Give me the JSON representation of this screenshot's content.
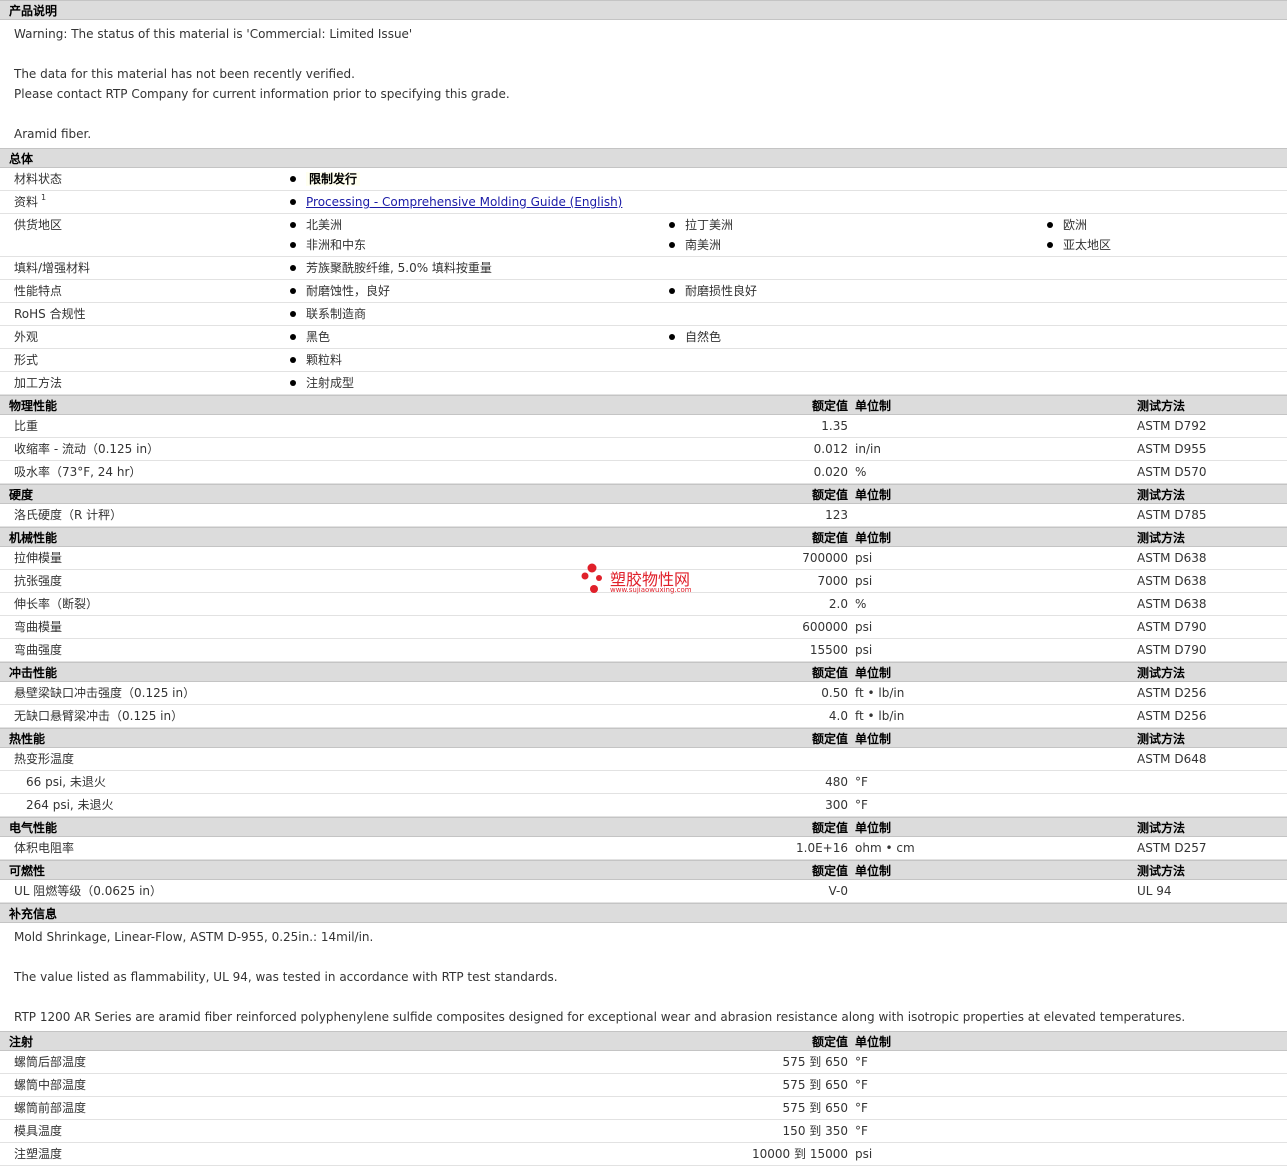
{
  "desc": {
    "title": "产品说明",
    "lines": [
      "Warning: The status of this material is 'Commercial: Limited Issue'",
      "",
      "The data for this material has not been recently verified.",
      "Please contact RTP Company for current information prior to specifying this grade.",
      "",
      "Aramid fiber."
    ]
  },
  "general": {
    "title": "总体",
    "status_label": "材料状态",
    "status_value": "限制发行",
    "docs_label": "资料",
    "docs_sup": "1",
    "docs_link": "Processing - Comprehensive Molding Guide (English)",
    "avail_label": "供货地区",
    "avail": [
      "北美洲",
      "拉丁美洲",
      "欧洲",
      "非洲和中东",
      "南美洲",
      "亚太地区"
    ],
    "filler_label": "填料/增强材料",
    "filler_value": "芳族聚酰胺纤维, 5.0% 填料按重量",
    "feat_label": "性能特点",
    "feat": [
      "耐磨蚀性，良好",
      "耐磨损性良好"
    ],
    "rohs_label": "RoHS 合规性",
    "rohs_value": "联系制造商",
    "appear_label": "外观",
    "appear": [
      "黑色",
      "自然色"
    ],
    "form_label": "形式",
    "form_value": "颗粒料",
    "proc_label": "加工方法",
    "proc_value": "注射成型"
  },
  "hdr": {
    "nominal": "额定值",
    "unit": "单位制",
    "method": "测试方法"
  },
  "physical": {
    "title": "物理性能",
    "rows": [
      {
        "label": "比重",
        "value": "1.35",
        "unit": "",
        "method": "ASTM D792"
      },
      {
        "label": "收缩率 - 流动（0.125 in）",
        "value": "0.012",
        "unit": "in/in",
        "method": "ASTM D955"
      },
      {
        "label": "吸水率（73°F, 24 hr）",
        "value": "0.020",
        "unit": "%",
        "method": "ASTM D570"
      }
    ]
  },
  "hardness": {
    "title": "硬度",
    "rows": [
      {
        "label": "洛氏硬度（R 计秤）",
        "value": "123",
        "unit": "",
        "method": "ASTM D785"
      }
    ]
  },
  "mechanical": {
    "title": "机械性能",
    "rows": [
      {
        "label": "拉伸模量",
        "value": "700000",
        "unit": "psi",
        "method": "ASTM D638"
      },
      {
        "label": "抗张强度",
        "value": "7000",
        "unit": "psi",
        "method": "ASTM D638"
      },
      {
        "label": "伸长率（断裂）",
        "value": "2.0",
        "unit": "%",
        "method": "ASTM D638"
      },
      {
        "label": "弯曲模量",
        "value": "600000",
        "unit": "psi",
        "method": "ASTM D790"
      },
      {
        "label": "弯曲强度",
        "value": "15500",
        "unit": "psi",
        "method": "ASTM D790"
      }
    ]
  },
  "impact": {
    "title": "冲击性能",
    "rows": [
      {
        "label": "悬壁梁缺口冲击强度（0.125 in）",
        "value": "0.50",
        "unit": "ft • lb/in",
        "method": "ASTM D256"
      },
      {
        "label": "无缺口悬臂梁冲击（0.125 in）",
        "value": "4.0",
        "unit": "ft • lb/in",
        "method": "ASTM D256"
      }
    ]
  },
  "thermal": {
    "title": "热性能",
    "hdt_label": "热变形温度",
    "hdt_method": "ASTM D648",
    "rows": [
      {
        "label": "66 psi, 未退火",
        "value": "480",
        "unit": "°F"
      },
      {
        "label": "264 psi, 未退火",
        "value": "300",
        "unit": "°F"
      }
    ]
  },
  "electrical": {
    "title": "电气性能",
    "rows": [
      {
        "label": "体积电阻率",
        "value": "1.0E+16",
        "unit": "ohm • cm",
        "method": "ASTM D257"
      }
    ]
  },
  "flammability": {
    "title": "可燃性",
    "rows": [
      {
        "label": "UL 阻燃等级（0.0625 in）",
        "value": "V-0",
        "unit": "",
        "method": "UL 94"
      }
    ]
  },
  "supp": {
    "title": "补充信息",
    "lines": [
      "Mold Shrinkage, Linear-Flow, ASTM D-955, 0.25in.: 14mil/in.",
      "",
      "The value listed as flammability, UL 94, was tested in accordance with RTP test standards.",
      "",
      "RTP 1200 AR Series are aramid fiber reinforced polyphenylene sulfide composites designed for exceptional wear and abrasion resistance along with isotropic properties at elevated temperatures."
    ]
  },
  "injection": {
    "title": "注射",
    "rows": [
      {
        "label": "螺筒后部温度",
        "value": "575 到 650",
        "unit": "°F"
      },
      {
        "label": "螺筒中部温度",
        "value": "575 到 650",
        "unit": "°F"
      },
      {
        "label": "螺筒前部温度",
        "value": "575 到 650",
        "unit": "°F"
      },
      {
        "label": "模具温度",
        "value": "150 到 350",
        "unit": "°F"
      },
      {
        "label": "注塑温度",
        "value": "10000 到 15000",
        "unit": "psi"
      }
    ]
  },
  "watermark": {
    "name": "塑胶物性网",
    "url": "www.sujiaowuxing.com"
  }
}
